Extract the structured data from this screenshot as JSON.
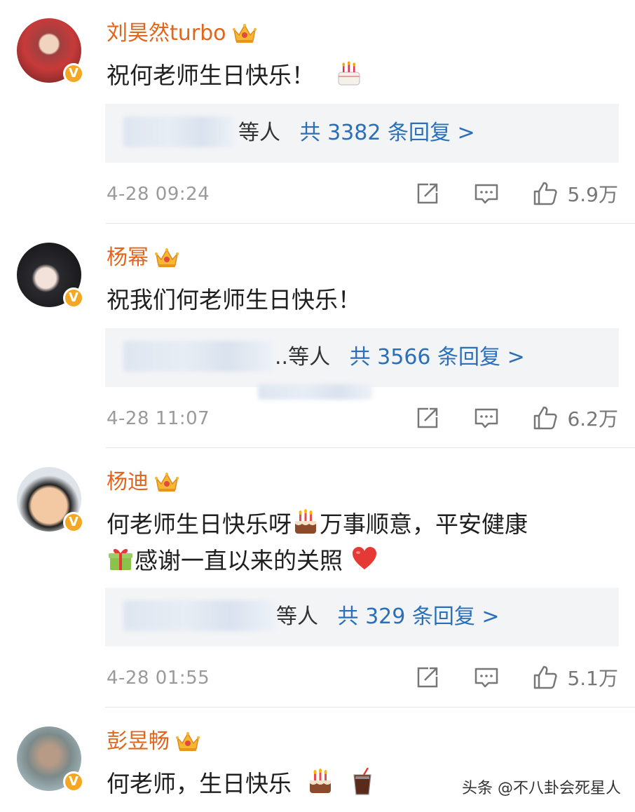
{
  "comments": [
    {
      "name": "刘昊然turbo",
      "text_parts": [
        "祝何老师生日快乐！"
      ],
      "reply_suffix": "等人",
      "reply_count": "共 3382 条回复 >",
      "time": "4-28 09:24",
      "likes": "5.9万"
    },
    {
      "name": "杨幂",
      "text_parts": [
        "祝我们何老师生日快乐！"
      ],
      "reply_suffix": "..等人",
      "reply_count": "共 3566 条回复 >",
      "time": "4-28 11:07",
      "likes": "6.2万"
    },
    {
      "name": "杨迪",
      "text_parts": [
        "何老师生日快乐呀",
        "万事顺意，平安健康",
        "感谢一直以来的关照"
      ],
      "reply_suffix": "等人",
      "reply_count": "共 329 条回复 >",
      "time": "4-28 01:55",
      "likes": "5.1万"
    },
    {
      "name": "彭昱畅",
      "text_parts": [
        "何老师，生日快乐"
      ]
    }
  ],
  "icons": {
    "verified": "verified-v-badge-icon",
    "crown": "crown-icon",
    "share": "share-icon",
    "comment": "comment-icon",
    "like": "thumbs-up-icon",
    "cake": "birthday-cake-icon",
    "gift": "gift-icon",
    "heart": "red-heart-icon",
    "drink": "cola-drink-icon"
  },
  "colors": {
    "name": "#e2651c",
    "reply_link": "#2a6fb8",
    "verified_badge": "#f5a623"
  },
  "watermark": "头条 @不八卦会死星人"
}
